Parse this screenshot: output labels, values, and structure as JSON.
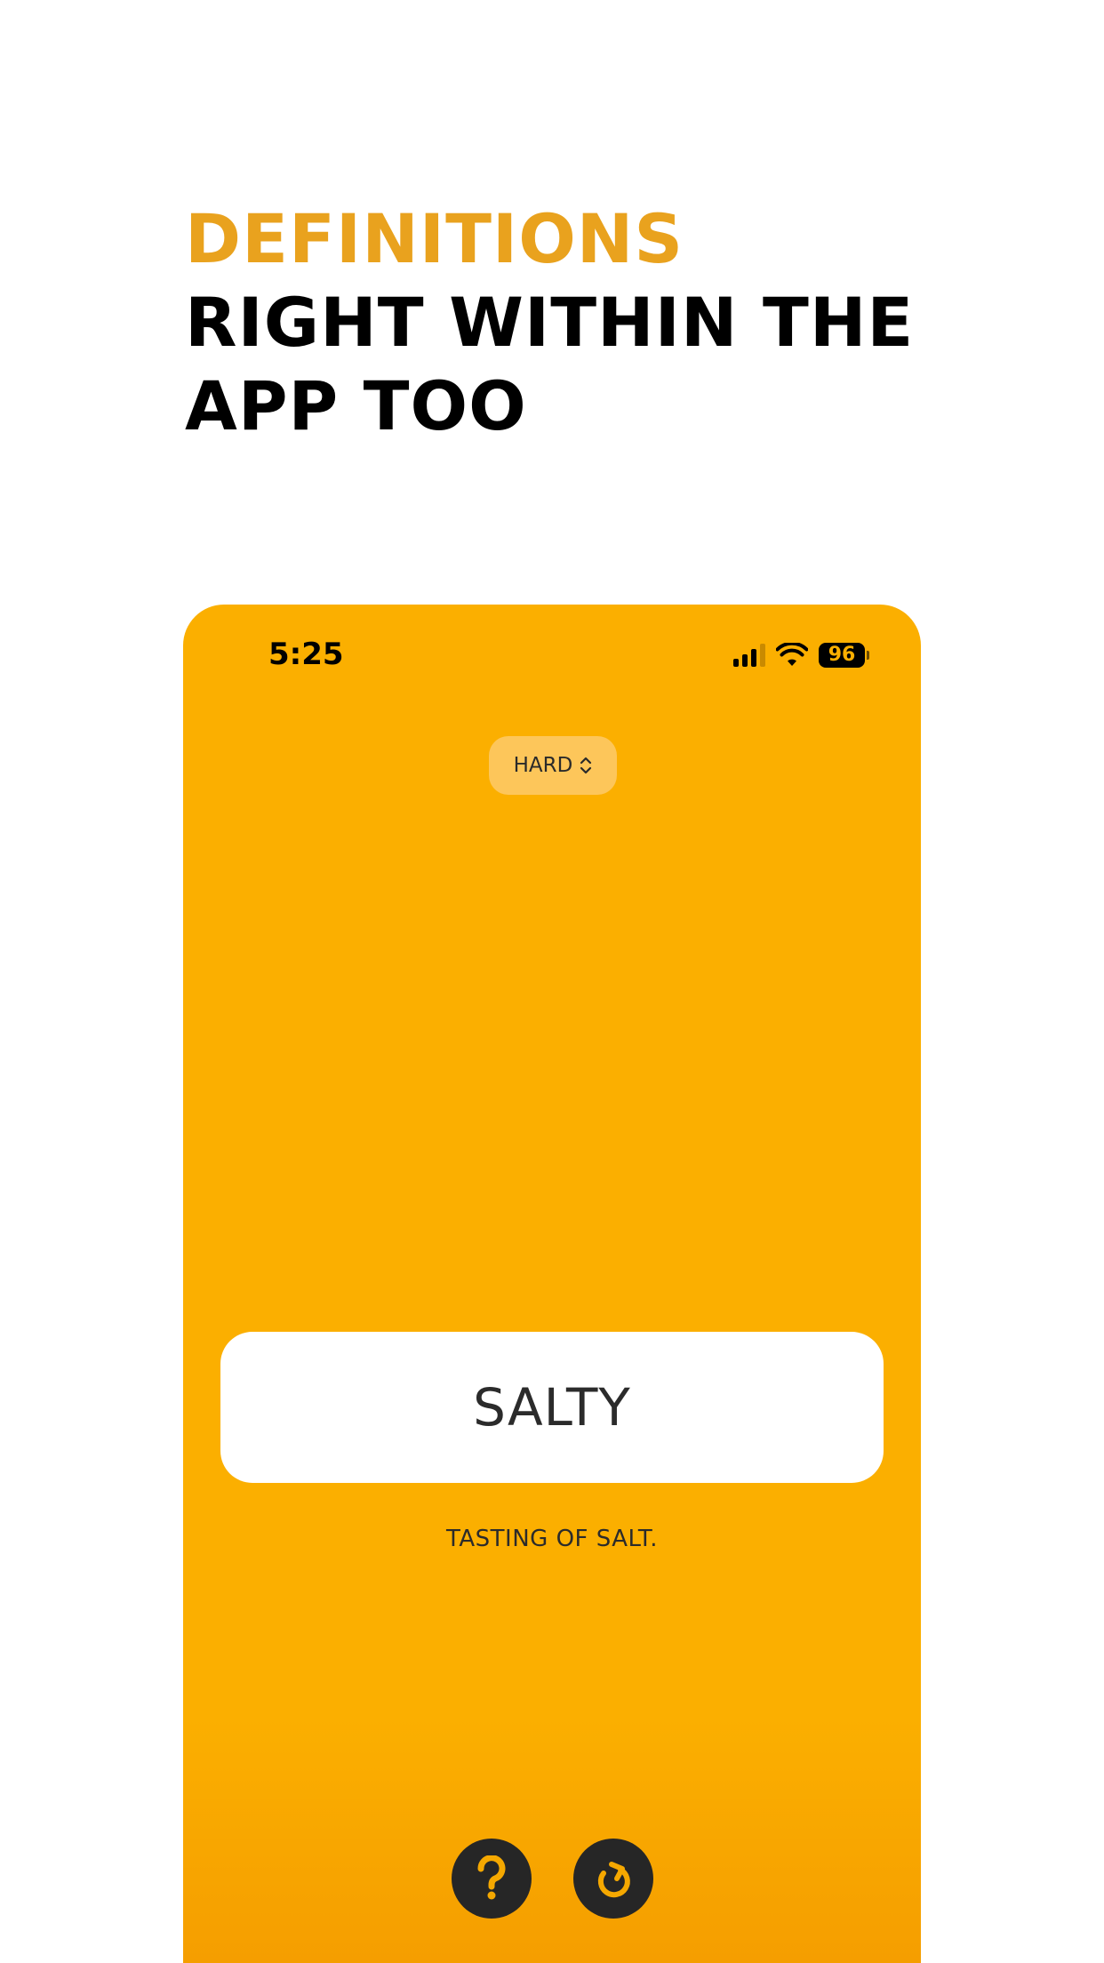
{
  "headline": {
    "accent": "DEFINITIONS",
    "line1": "RIGHT WITHIN THE",
    "line2": "APP TOO"
  },
  "status_bar": {
    "time": "5:25",
    "battery": "96"
  },
  "difficulty": {
    "label": "HARD"
  },
  "card": {
    "word": "SALTY",
    "definition": "TASTING OF SALT."
  },
  "controls": {
    "help_icon": "question-mark-icon",
    "refresh_icon": "refresh-icon"
  },
  "colors": {
    "accent": "#E9A21E",
    "phone_bg": "#FBAF00",
    "button_bg": "#262626",
    "button_icon": "#F5A800"
  }
}
